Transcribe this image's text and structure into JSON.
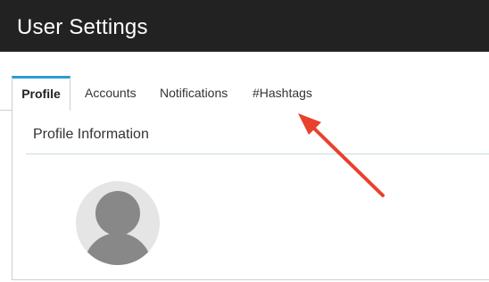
{
  "header": {
    "title": "User Settings"
  },
  "tabs": [
    {
      "label": "Profile",
      "active": true
    },
    {
      "label": "Accounts",
      "active": false
    },
    {
      "label": "Notifications",
      "active": false
    },
    {
      "label": "#Hashtags",
      "active": false
    }
  ],
  "panel": {
    "title": "Profile Information"
  },
  "colors": {
    "header_bg": "#222222",
    "active_tab_accent": "#2a9bd6",
    "annotation_arrow": "#e8412c",
    "avatar_bg": "#e5e5e5",
    "avatar_fg": "#888888"
  },
  "icons": {
    "avatar": "default-user-avatar-icon",
    "annotation": "red-arrow-annotation"
  }
}
